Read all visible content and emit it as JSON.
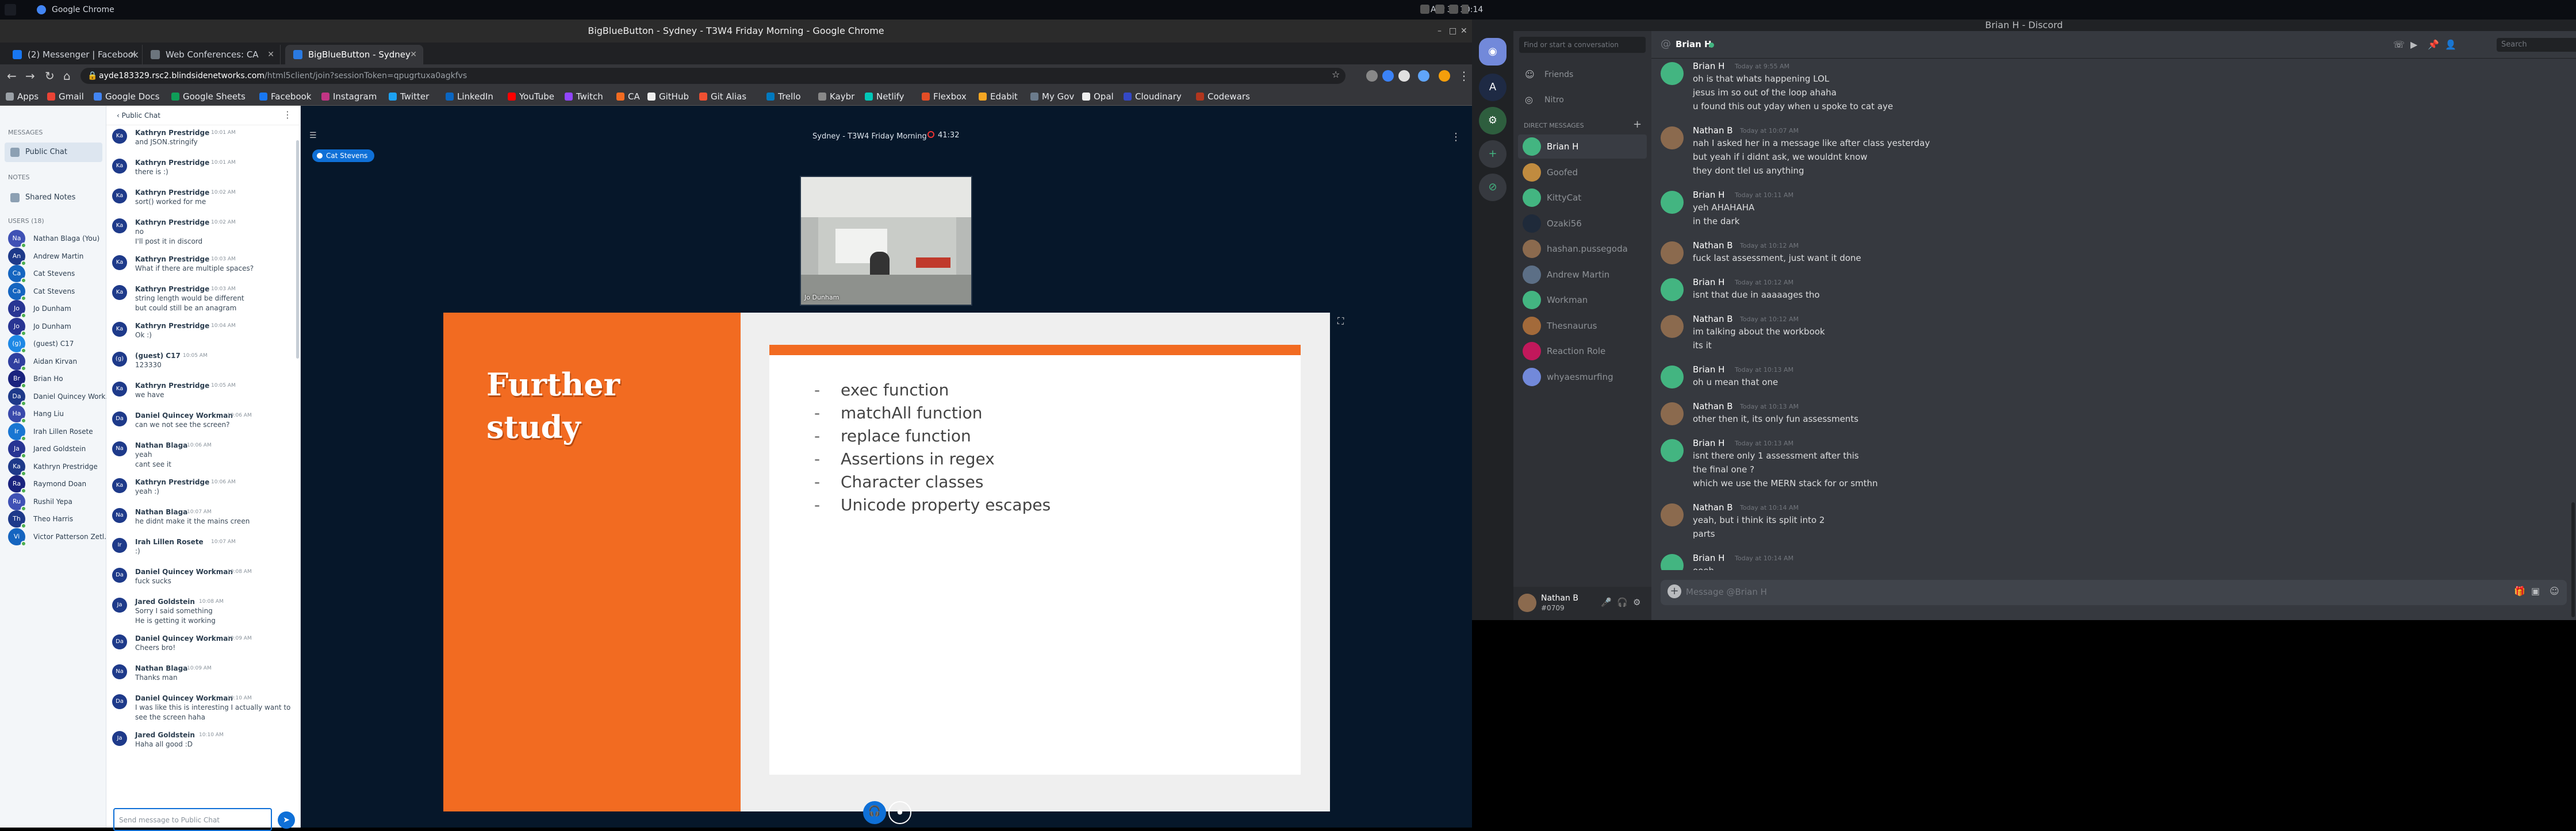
{
  "topbar": {
    "app": "Google Chrome",
    "clock": "Apr 30 10:14"
  },
  "chrome": {
    "window_title": "BigBlueButton - Sydney - T3W4 Friday Morning - Google Chrome",
    "tabs": [
      {
        "label": "(2) Messenger | Facebook",
        "color": "#1877f2"
      },
      {
        "label": "Web Conferences: CA",
        "color": "#6c757d"
      },
      {
        "label": "BigBlueButton - Sydney",
        "color": "#2a7ae2"
      }
    ],
    "url_host": "ayde183329.rsc2.blindsidenetworks.com",
    "url_path": "/html5client/join?sessionToken=qpugrtuxa0agkfvs",
    "bookmarks": [
      {
        "label": "Apps",
        "color": "#9aa0a6"
      },
      {
        "label": "Gmail",
        "color": "#ea4335"
      },
      {
        "label": "Google Docs",
        "color": "#4285f4"
      },
      {
        "label": "Google Sheets",
        "color": "#0f9d58"
      },
      {
        "label": "Facebook",
        "color": "#1877f2"
      },
      {
        "label": "Instagram",
        "color": "#c13584"
      },
      {
        "label": "Twitter",
        "color": "#1da1f2"
      },
      {
        "label": "LinkedIn",
        "color": "#0a66c2"
      },
      {
        "label": "YouTube",
        "color": "#ff0000"
      },
      {
        "label": "Twitch",
        "color": "#9146ff"
      },
      {
        "label": "CA",
        "color": "#f26b21"
      },
      {
        "label": "GitHub",
        "color": "#eeeeee"
      },
      {
        "label": "Git Alias",
        "color": "#f05032"
      },
      {
        "label": "Trello",
        "color": "#0079bf"
      },
      {
        "label": "Kaybr",
        "color": "#888888"
      },
      {
        "label": "Netlify",
        "color": "#00c7b7"
      },
      {
        "label": "Flexbox",
        "color": "#e44d26"
      },
      {
        "label": "Edabit",
        "color": "#f5a623"
      },
      {
        "label": "My Gov",
        "color": "#6b7b8c"
      },
      {
        "label": "Opal",
        "color": "#eeeeee"
      },
      {
        "label": "Cloudinary",
        "color": "#3448c5"
      },
      {
        "label": "Codewars",
        "color": "#b1361e"
      }
    ]
  },
  "bbb": {
    "messages_label": "MESSAGES",
    "public_chat_label": "Public Chat",
    "notes_label": "NOTES",
    "shared_notes_label": "Shared Notes",
    "users_label": "USERS (18)",
    "users": [
      {
        "initials": "Na",
        "name": "Nathan Blaga (You)",
        "color": "#3f51b5"
      },
      {
        "initials": "An",
        "name": "Andrew Martin",
        "color": "#1e3a8a"
      },
      {
        "initials": "Ca",
        "name": "Cat Stevens",
        "color": "#1565c0"
      },
      {
        "initials": "Ca",
        "name": "Cat Stevens",
        "color": "#1565c0"
      },
      {
        "initials": "Jo",
        "name": "Jo Dunham",
        "color": "#283593"
      },
      {
        "initials": "Jo",
        "name": "Jo Dunham",
        "color": "#283593"
      },
      {
        "initials": "(g)",
        "name": "(guest) C17",
        "color": "#1e88e5"
      },
      {
        "initials": "Ai",
        "name": "Aidan Kirvan",
        "color": "#303f9f"
      },
      {
        "initials": "Br",
        "name": "Brian Ho",
        "color": "#1a237e"
      },
      {
        "initials": "Da",
        "name": "Daniel Quincey Work...",
        "color": "#1e3a8a"
      },
      {
        "initials": "Ha",
        "name": "Hang Liu",
        "color": "#3949ab"
      },
      {
        "initials": "Ir",
        "name": "Irah Lillen Rosete",
        "color": "#1976d2"
      },
      {
        "initials": "Ja",
        "name": "Jared Goldstein",
        "color": "#283593"
      },
      {
        "initials": "Ka",
        "name": "Kathryn Prestridge",
        "color": "#1e3a8a"
      },
      {
        "initials": "Ra",
        "name": "Raymond Doan",
        "color": "#1a237e"
      },
      {
        "initials": "Ru",
        "name": "Rushil Yepa",
        "color": "#3f51b5"
      },
      {
        "initials": "Th",
        "name": "Theo Harris",
        "color": "#1e3a8a"
      },
      {
        "initials": "Vi",
        "name": "Victor Patterson Zetl...",
        "color": "#1565c0"
      }
    ],
    "chat_header": "‹ Public Chat",
    "chat_placeholder": "Send message to Public Chat",
    "chat": [
      {
        "initials": "Ka",
        "name": "Kathryn Prestridge",
        "time": "10:01 AM",
        "lines": [
          "and JSON.stringify"
        ]
      },
      {
        "initials": "Ka",
        "name": "Kathryn Prestridge",
        "time": "10:01 AM",
        "lines": [
          "there is :)"
        ]
      },
      {
        "initials": "Ka",
        "name": "Kathryn Prestridge",
        "time": "10:02 AM",
        "lines": [
          "sort() worked for me"
        ]
      },
      {
        "initials": "Ka",
        "name": "Kathryn Prestridge",
        "time": "10:02 AM",
        "lines": [
          "no",
          "I'll post it in discord"
        ]
      },
      {
        "initials": "Ka",
        "name": "Kathryn Prestridge",
        "time": "10:03 AM",
        "lines": [
          "What if there are multiple spaces?"
        ]
      },
      {
        "initials": "Ka",
        "name": "Kathryn Prestridge",
        "time": "10:03 AM",
        "lines": [
          "string length would be different",
          "but could still be an anagram"
        ]
      },
      {
        "initials": "Ka",
        "name": "Kathryn Prestridge",
        "time": "10:04 AM",
        "lines": [
          "Ok :)"
        ]
      },
      {
        "initials": "(g)",
        "name": "(guest) C17",
        "time": "10:05 AM",
        "lines": [
          "123330"
        ]
      },
      {
        "initials": "Ka",
        "name": "Kathryn Prestridge",
        "time": "10:05 AM",
        "lines": [
          "we have"
        ]
      },
      {
        "initials": "Da",
        "name": "Daniel Quincey Workman",
        "time": "10:06 AM",
        "lines": [
          "can we not see the screen?"
        ]
      },
      {
        "initials": "Na",
        "name": "Nathan Blaga",
        "time": "10:06 AM",
        "lines": [
          "yeah",
          "cant see it"
        ]
      },
      {
        "initials": "Ka",
        "name": "Kathryn Prestridge",
        "time": "10:06 AM",
        "lines": [
          "yeah :)"
        ]
      },
      {
        "initials": "Na",
        "name": "Nathan Blaga",
        "time": "10:07 AM",
        "lines": [
          "he didnt make it the mains creen"
        ]
      },
      {
        "initials": "Ir",
        "name": "Irah Lillen Rosete",
        "time": "10:07 AM",
        "lines": [
          ":)"
        ]
      },
      {
        "initials": "Da",
        "name": "Daniel Quincey Workman",
        "time": "10:08 AM",
        "lines": [
          "fuck sucks"
        ]
      },
      {
        "initials": "Ja",
        "name": "Jared Goldstein",
        "time": "10:08 AM",
        "lines": [
          "Sorry I said something",
          "He is getting it working"
        ]
      },
      {
        "initials": "Da",
        "name": "Daniel Quincey Workman",
        "time": "10:09 AM",
        "lines": [
          "Cheers bro!"
        ]
      },
      {
        "initials": "Na",
        "name": "Nathan Blaga",
        "time": "10:09 AM",
        "lines": [
          "Thanks man"
        ]
      },
      {
        "initials": "Da",
        "name": "Daniel Quincey Workman",
        "time": "10:10 AM",
        "lines": [
          "I was like this is interesting I actually want to",
          "see the screen haha"
        ]
      },
      {
        "initials": "Ja",
        "name": "Jared Goldstein",
        "time": "10:10 AM",
        "lines": [
          "Haha all good :D"
        ]
      }
    ],
    "meeting_title": "Sydney - T3W4 Friday Morning",
    "recording_time": "41:32",
    "talker": "Cat Stevens",
    "webcam_label": "Jo Dunham",
    "slide": {
      "title_line1": "Further",
      "title_line2": "study",
      "bullets": [
        "exec function",
        "matchAll function",
        "replace function",
        "Assertions in regex",
        "Character classes",
        "Unicode property escapes"
      ],
      "dash": "-"
    }
  },
  "discord": {
    "window_title": "Brian H - Discord",
    "search_placeholder": "Find or start a conversation",
    "nav": [
      {
        "label": "Friends",
        "icon": "☺"
      },
      {
        "label": "Nitro",
        "icon": "◎"
      }
    ],
    "dm_label": "DIRECT MESSAGES",
    "dms": [
      {
        "name": "Brian H",
        "color": "#43b581"
      },
      {
        "name": "Goofed",
        "color": "#c08b3f"
      },
      {
        "name": "KittyCat",
        "color": "#43b581"
      },
      {
        "name": "Ozaki56",
        "color": "#1f2a3a"
      },
      {
        "name": "hashan.pussegoda",
        "color": "#8b6a4e"
      },
      {
        "name": "Andrew Martin",
        "color": "#5c6f86"
      },
      {
        "name": "Workman",
        "color": "#43b581"
      },
      {
        "name": "Thesnaurus",
        "color": "#a36a3a"
      },
      {
        "name": "Reaction Role",
        "color": "#c2185b"
      },
      {
        "name": "whyaesmurfing",
        "color": "#7289da"
      }
    ],
    "me": {
      "name": "Nathan B",
      "tag": "#0709"
    },
    "header_name": "Brian H",
    "search_label": "Search",
    "input_placeholder": "Message @Brian H",
    "messages": [
      {
        "author": "Brian H",
        "time": "Today at 9:55 AM",
        "color": "#43b581",
        "lines": [
          "oh is that whats happening LOL",
          "jesus im so out of the loop ahaha",
          "u found this out yday when u spoke to cat aye"
        ]
      },
      {
        "author": "Nathan B",
        "time": "Today at 10:07 AM",
        "color": "#8b6a4e",
        "lines": [
          "nah I asked her in a message like after class yesterday",
          "but yeah if i didnt ask, we wouldnt know",
          "they dont tlel us anything"
        ]
      },
      {
        "author": "Brian H",
        "time": "Today at 10:11 AM",
        "color": "#43b581",
        "lines": [
          "yeh AHAHAHA",
          "in the dark"
        ]
      },
      {
        "author": "Nathan B",
        "time": "Today at 10:12 AM",
        "color": "#8b6a4e",
        "lines": [
          "fuck last assessment, just want it done"
        ]
      },
      {
        "author": "Brian H",
        "time": "Today at 10:12 AM",
        "color": "#43b581",
        "lines": [
          "isnt that due in aaaaages tho"
        ]
      },
      {
        "author": "Nathan B",
        "time": "Today at 10:12 AM",
        "color": "#8b6a4e",
        "lines": [
          "im talking about the workbook",
          "its it"
        ]
      },
      {
        "author": "Brian H",
        "time": "Today at 10:13 AM",
        "color": "#43b581",
        "lines": [
          "oh u mean that one"
        ]
      },
      {
        "author": "Nathan B",
        "time": "Today at 10:13 AM",
        "color": "#8b6a4e",
        "lines": [
          "other then it, its only fun assessments"
        ]
      },
      {
        "author": "Brian H",
        "time": "Today at 10:13 AM",
        "color": "#43b581",
        "lines": [
          "isnt there only 1 assessment after this",
          "the final one ?",
          "which we use the MERN stack for or smthn"
        ]
      },
      {
        "author": "Nathan B",
        "time": "Today at 10:14 AM",
        "color": "#8b6a4e",
        "lines": [
          "yeah, but i think its split into 2",
          "parts"
        ]
      },
      {
        "author": "Brian H",
        "time": "Today at 10:14 AM",
        "color": "#43b581",
        "lines": [
          "oooh"
        ]
      }
    ]
  }
}
